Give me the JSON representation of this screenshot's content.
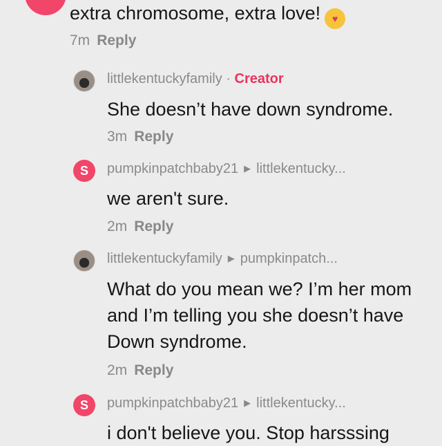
{
  "top_comment": {
    "text": "extra chromosome, extra love!",
    "emoji": "smiling-face-with-hearts",
    "time": "7m",
    "reply": "Reply"
  },
  "replies": [
    {
      "user": "littlekentuckyfamily",
      "separator": "·",
      "badge": "Creator",
      "text": [
        "She doesn’t have down syndrome."
      ],
      "time": "3m",
      "reply": "Reply"
    },
    {
      "avatar_letter": "S",
      "user": "pumpkinpatchbaby21",
      "reply_to": "littlekentucky...",
      "text": [
        "we aren't sure."
      ],
      "time": "2m",
      "reply": "Reply"
    },
    {
      "user": "littlekentuckyfamily",
      "reply_to": "pumpkinpatch...",
      "text": [
        "What do you mean we? I’m her mom",
        "and I’m telling you she doesn’t have",
        "Down syndrome."
      ],
      "time": "2m",
      "reply": "Reply"
    },
    {
      "avatar_letter": "S",
      "user": "pumpkinpatchbaby21",
      "reply_to": "littlekentucky...",
      "text": [
        "i don't believe you. Stop harsssing"
      ]
    }
  ],
  "colors": {
    "accent": "#e9335f",
    "background": "#ececec"
  }
}
